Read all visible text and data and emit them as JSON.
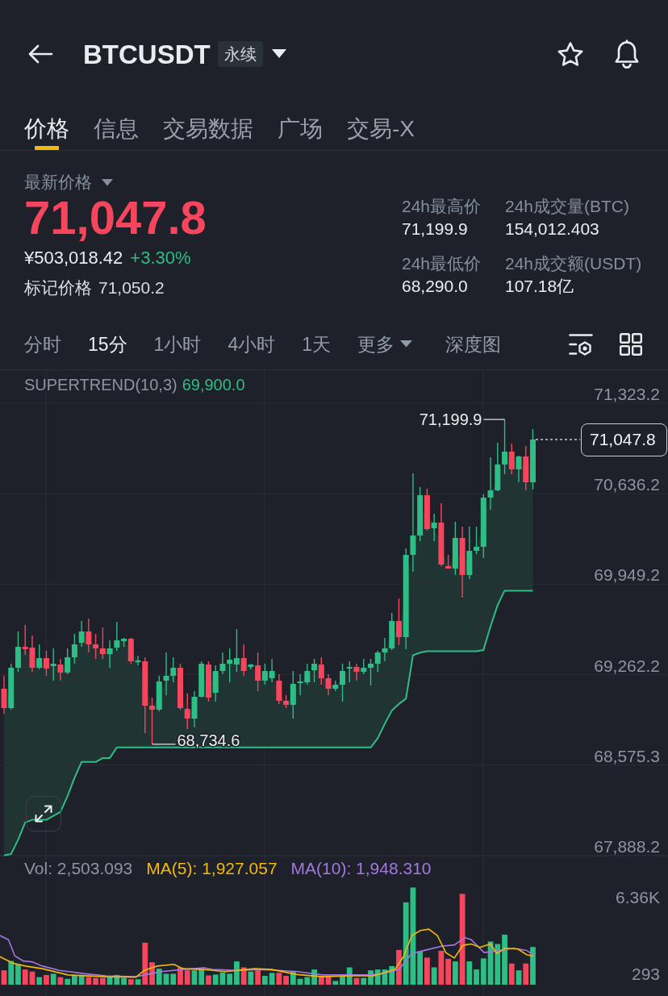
{
  "header": {
    "symbol": "BTCUSDT",
    "contract_type": "永续"
  },
  "tabs": [
    {
      "label": "价格",
      "selected": true
    },
    {
      "label": "信息",
      "selected": false
    },
    {
      "label": "交易数据",
      "selected": false
    },
    {
      "label": "广场",
      "selected": false
    },
    {
      "label": "交易-X",
      "selected": false
    }
  ],
  "ticker": {
    "label": "最新价格",
    "last_price": "71,047.8",
    "fiat_price": "¥503,018.42",
    "change": "+3.30%",
    "mark_label": "标记价格",
    "mark_price": "71,050.2"
  },
  "stats": [
    {
      "label": "24h最高价",
      "value": "71,199.9"
    },
    {
      "label": "24h成交量(BTC)",
      "value": "154,012.403"
    },
    {
      "label": "24h最低价",
      "value": "68,290.0"
    },
    {
      "label": "24h成交额(USDT)",
      "value": "107.18亿"
    }
  ],
  "intervals": [
    {
      "label": "分时",
      "kind": "interval",
      "selected": false
    },
    {
      "label": "15分",
      "kind": "interval",
      "selected": true
    },
    {
      "label": "1小时",
      "kind": "interval",
      "selected": false
    },
    {
      "label": "4小时",
      "kind": "interval",
      "selected": false
    },
    {
      "label": "1天",
      "kind": "interval",
      "selected": false
    },
    {
      "label": "更多",
      "kind": "menu",
      "selected": false
    },
    {
      "label": "深度图",
      "kind": "view",
      "selected": false
    }
  ],
  "chart": {
    "indicator_value": "69,900.0",
    "last_price": "71,047.8",
    "high_label": "71,199.9",
    "low_label": "68,734.6",
    "chart_data": {
      "type": "candlestick",
      "grid": true,
      "ylim": [
        67888.2,
        71580.4
      ],
      "yticks": [
        {
          "value": 71323.2,
          "label": "71,323.2"
        },
        {
          "value": 70636.2,
          "label": "70,636.2"
        },
        {
          "value": 69949.2,
          "label": "69,949.2"
        },
        {
          "value": 69262.2,
          "label": "69,262.2"
        },
        {
          "value": 68575.3,
          "label": "68,575.3"
        },
        {
          "value": 67888.2,
          "label": "67,888.2"
        }
      ],
      "ohlc": [
        [
          69155.7,
          69253.6,
          68965.8,
          69008.7
        ],
        [
          69008.7,
          69345.5,
          68996.5,
          69314.9
        ],
        [
          69314.9,
          69590.4,
          69284.2,
          69474.1
        ],
        [
          69474.1,
          69639.4,
          69412.8,
          69455.7
        ],
        [
          69467.9,
          69559.8,
          69284.2,
          69314.9
        ],
        [
          69314.9,
          69492.4,
          69302.6,
          69388.3
        ],
        [
          69388.3,
          69443.4,
          69253.6,
          69308.7
        ],
        [
          69327.1,
          69461.8,
          69216.9,
          69345.5
        ],
        [
          69339.3,
          69382.2,
          69216.9,
          69278.1
        ],
        [
          69278.1,
          69461.8,
          69265.9,
          69394.5
        ],
        [
          69394.5,
          69572.0,
          69345.5,
          69492.4
        ],
        [
          69504.7,
          69670.0,
          69474.1,
          69590.4
        ],
        [
          69590.4,
          69688.4,
          69431.2,
          69492.4
        ],
        [
          69492.4,
          69572.0,
          69382.2,
          69461.8
        ],
        [
          69461.8,
          69621.0,
          69382.2,
          69418.9
        ],
        [
          69418.9,
          69523.0,
          69314.9,
          69461.8
        ],
        [
          69467.9,
          69663.9,
          69443.4,
          69523.0
        ],
        [
          69516.9,
          69541.4,
          69474.1,
          69535.3
        ],
        [
          69535.3,
          69541.4,
          69345.5,
          69363.8
        ],
        [
          69357.7,
          69406.7,
          69333.2,
          69370.0
        ],
        [
          69363.8,
          69394.5,
          68818.9,
          69027.1
        ],
        [
          69027.1,
          69088.3,
          68734.6,
          68996.5
        ],
        [
          68996.5,
          69253.6,
          68984.2,
          69210.8
        ],
        [
          69216.9,
          69431.2,
          69106.7,
          69253.6
        ],
        [
          69253.6,
          69394.5,
          69204.6,
          69314.9
        ],
        [
          69314.9,
          69345.5,
          68996.5,
          69008.7
        ],
        [
          69002.6,
          69118.9,
          68849.5,
          68929.1
        ],
        [
          68929.1,
          69137.3,
          68861.8,
          69094.4
        ],
        [
          69094.4,
          69363.8,
          69088.3,
          69345.5
        ],
        [
          69339.3,
          69363.8,
          69057.7,
          69088.3
        ],
        [
          69125.0,
          69333.2,
          69057.7,
          69290.4
        ],
        [
          69290.4,
          69431.2,
          69265.9,
          69345.5
        ],
        [
          69345.5,
          69461.8,
          69204.6,
          69376.1
        ],
        [
          69339.3,
          69608.8,
          69284.2,
          69388.3
        ],
        [
          69388.3,
          69492.4,
          69253.6,
          69290.4
        ],
        [
          69321.0,
          69345.5,
          69302.6,
          69339.3
        ],
        [
          69333.2,
          69431.2,
          69137.3,
          69216.9
        ],
        [
          69216.9,
          69345.5,
          69186.3,
          69290.4
        ],
        [
          69235.3,
          69382.2,
          69204.6,
          69290.4
        ],
        [
          69216.9,
          69265.9,
          69039.3,
          69063.8
        ],
        [
          69063.8,
          69106.7,
          69008.7,
          69033.2
        ],
        [
          69033.2,
          69290.4,
          68929.1,
          69192.4
        ],
        [
          69198.5,
          69265.9,
          69106.7,
          69210.8
        ],
        [
          69204.6,
          69345.5,
          69186.3,
          69290.4
        ],
        [
          69296.5,
          69382.2,
          69204.6,
          69345.5
        ],
        [
          69339.3,
          69394.5,
          69186.3,
          69235.3
        ],
        [
          69235.3,
          69265.9,
          69106.7,
          69155.7
        ],
        [
          69155.7,
          69216.9,
          69137.3,
          69186.3
        ],
        [
          69186.3,
          69345.5,
          69057.7,
          69290.4
        ],
        [
          69308.7,
          69363.8,
          69204.6,
          69321.0
        ],
        [
          69321.0,
          69345.5,
          69216.9,
          69284.2
        ],
        [
          69284.2,
          69382.2,
          69265.9,
          69314.9
        ],
        [
          69314.9,
          69382.2,
          69180.1,
          69345.5
        ],
        [
          69345.5,
          69443.4,
          69284.2,
          69431.2
        ],
        [
          69431.2,
          69541.4,
          69363.8,
          69461.8
        ],
        [
          69461.8,
          69731.2,
          69449.6,
          69670.0
        ],
        [
          69670.0,
          69841.4,
          69486.3,
          69547.5
        ],
        [
          69547.5,
          70221.1,
          69455.7,
          70172.1
        ],
        [
          70172.1,
          70790.5,
          70043.5,
          70319.0
        ],
        [
          70319.0,
          70686.4,
          70276.2,
          70625.2
        ],
        [
          70625.2,
          70674.2,
          70355.8,
          70368.0
        ],
        [
          70374.1,
          70484.3,
          70276.2,
          70417.0
        ],
        [
          70417.0,
          70563.9,
          70086.4,
          70098.6
        ],
        [
          70086.4,
          70172.1,
          70068.0,
          70068.0
        ],
        [
          70068.0,
          70423.1,
          70019.0,
          70300.7
        ],
        [
          70300.7,
          70386.4,
          69847.6,
          70019.0
        ],
        [
          70019.0,
          70386.4,
          69988.4,
          70202.7
        ],
        [
          70202.7,
          70386.4,
          70178.2,
          70233.3
        ],
        [
          70233.3,
          70631.3,
          70147.6,
          70606.8
        ],
        [
          70606.8,
          70913.0,
          70515.0,
          70661.9
        ],
        [
          70661.9,
          71023.2,
          70655.8,
          70857.9
        ],
        [
          70857.9,
          71199.9,
          70784.4,
          70955.8
        ],
        [
          70955.8,
          71017.0,
          70784.4,
          70821.1
        ],
        [
          70821.1,
          70925.2,
          70723.1,
          70919.1
        ],
        [
          70919.1,
          70998.7,
          70661.9,
          70723.1
        ],
        [
          70723.1,
          71127.3,
          70668.0,
          71047.8
        ]
      ],
      "series": [
        {
          "name": "SUPERTREND(10,3)",
          "type": "line",
          "color": "#2ebd85",
          "values": [
            67890,
            67900,
            68010,
            68140,
            68160,
            68160,
            68160,
            68190,
            68220,
            68340,
            68480,
            68600,
            68600,
            68600,
            68630,
            68630,
            68710,
            68710,
            68710,
            68710,
            68710,
            68710,
            68710,
            68710,
            68710,
            68710,
            68710,
            68710,
            68710,
            68710,
            68710,
            68710,
            68710,
            68710,
            68710,
            68710,
            68710,
            68710,
            68710,
            68710,
            68710,
            68710,
            68710,
            68710,
            68710,
            68710,
            68710,
            68710,
            68710,
            68710,
            68710,
            68710,
            68710,
            68780,
            68890,
            68990,
            69040,
            69080,
            69410,
            69430,
            69440,
            69440,
            69440,
            69440,
            69440,
            69440,
            69440,
            69440,
            69450,
            69630,
            69790,
            69900,
            69900,
            69900,
            69900,
            69900
          ]
        }
      ]
    }
  },
  "volume": {
    "legend": [
      {
        "text": "Vol: 2,503.093",
        "color": "#8e949e"
      },
      {
        "text": "MA(5): 1,927.057",
        "color": "#f0b90b"
      },
      {
        "text": "MA(10): 1,948.310",
        "color": "#a278e0"
      }
    ],
    "axis": [
      "6.36K",
      "293"
    ]
  }
}
